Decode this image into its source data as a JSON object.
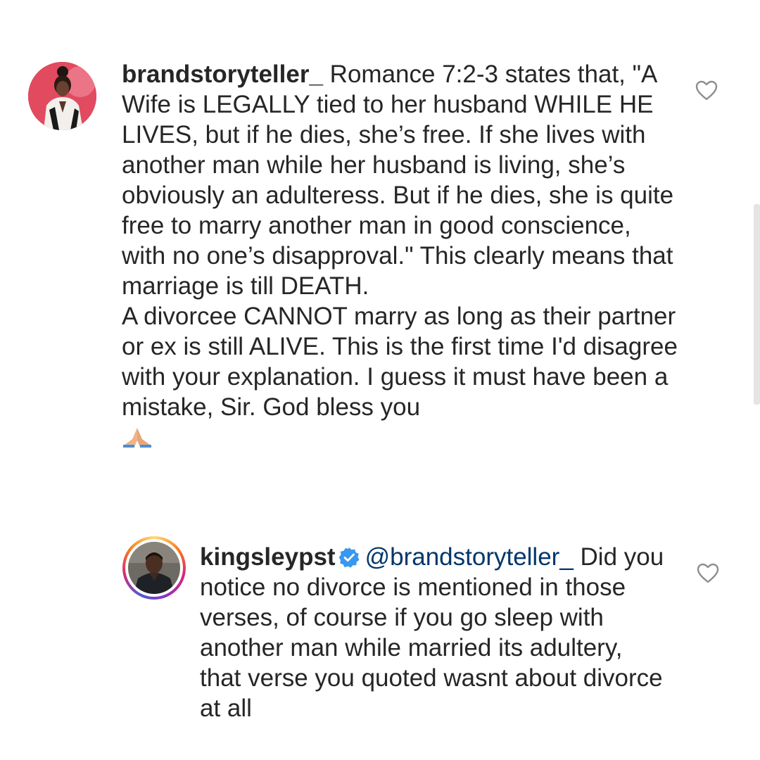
{
  "comments": [
    {
      "username": "brandstoryteller_",
      "paragraphs": [
        "Romance 7:2-3 states that, \"A Wife is LEGALLY tied to her husband WHILE HE LIVES, but if he dies, she’s free. If she lives with another man while her husband is living, she’s obviously an adulteress. But if he dies, she is quite free to marry another man in good conscience, with no one’s disapproval.\" This clearly means that marriage is till DEATH.",
        "A divorcee CANNOT marry as long as their partner or ex is still ALIVE.  This is the first time I'd disagree with your explanation. I guess it must have been a mistake, Sir. God bless you"
      ],
      "emoji_icon": "praying-hands-icon",
      "avatar_icon": "user-avatar-photo",
      "like_icon": "heart-outline-icon"
    },
    {
      "username": "kingsleypst",
      "verified_icon": "verified-badge-icon",
      "mention": "@brandstoryteller_",
      "text": "Did you notice no divorce is mentioned in those verses,  of course if you go sleep with another man while married its adultery,  that verse you quoted wasnt about divorce at all",
      "avatar_icon": "user-avatar-photo-story-ring",
      "like_icon": "heart-outline-icon"
    }
  ],
  "colors": {
    "text": "#262626",
    "mention": "#00376b",
    "verified": "#3897f0",
    "avatar_bg": "#e0455c"
  }
}
